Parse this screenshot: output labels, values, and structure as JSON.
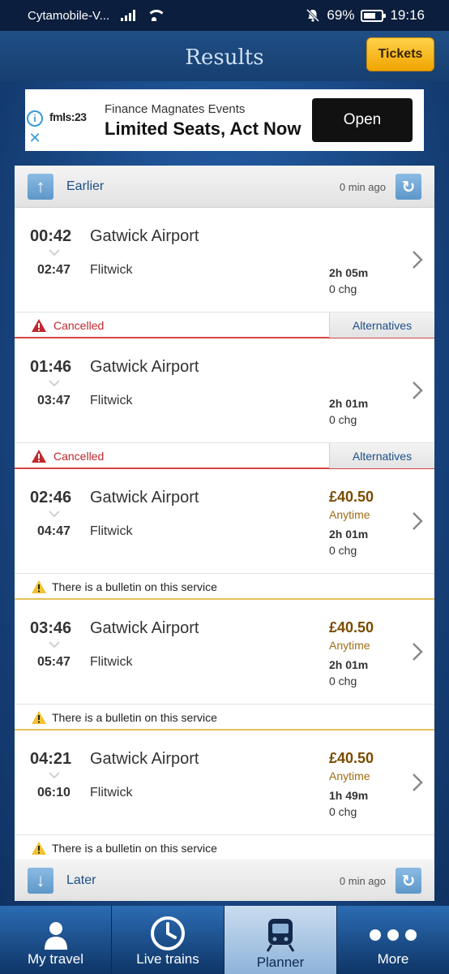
{
  "status_bar": {
    "carrier": "Cytamobile-V...",
    "battery": "69%",
    "time": "19:16",
    "battery_level": 0.69
  },
  "header": {
    "title": "Results",
    "tickets_label": "Tickets"
  },
  "ad": {
    "logo": "fmls:23",
    "line1": "Finance Magnates Events",
    "line2": "Limited Seats, Act Now",
    "open_label": "Open"
  },
  "earlier": {
    "label": "Earlier",
    "updated": "0 min ago"
  },
  "later": {
    "label": "Later",
    "updated": "0 min ago"
  },
  "journeys": [
    {
      "dep_time": "00:42",
      "dep_station": "Gatwick Airport",
      "arr_time": "02:47",
      "arr_station": "Flitwick",
      "fare": "",
      "fare_type": "",
      "duration": "2h 05m",
      "changes": "0 chg",
      "status": "Cancelled",
      "status_kind": "cancelled",
      "alt_label": "Alternatives"
    },
    {
      "dep_time": "01:46",
      "dep_station": "Gatwick Airport",
      "arr_time": "03:47",
      "arr_station": "Flitwick",
      "fare": "",
      "fare_type": "",
      "duration": "2h 01m",
      "changes": "0 chg",
      "status": "Cancelled",
      "status_kind": "cancelled",
      "alt_label": "Alternatives"
    },
    {
      "dep_time": "02:46",
      "dep_station": "Gatwick Airport",
      "arr_time": "04:47",
      "arr_station": "Flitwick",
      "fare": "£40.50",
      "fare_type": "Anytime",
      "duration": "2h 01m",
      "changes": "0 chg",
      "status": "There is a bulletin on this service",
      "status_kind": "bulletin",
      "alt_label": ""
    },
    {
      "dep_time": "03:46",
      "dep_station": "Gatwick Airport",
      "arr_time": "05:47",
      "arr_station": "Flitwick",
      "fare": "£40.50",
      "fare_type": "Anytime",
      "duration": "2h 01m",
      "changes": "0 chg",
      "status": "There is a bulletin on this service",
      "status_kind": "bulletin",
      "alt_label": ""
    },
    {
      "dep_time": "04:21",
      "dep_station": "Gatwick Airport",
      "arr_time": "06:10",
      "arr_station": "Flitwick",
      "fare": "£40.50",
      "fare_type": "Anytime",
      "duration": "1h 49m",
      "changes": "0 chg",
      "status": "There is a bulletin on this service",
      "status_kind": "bulletin",
      "alt_label": ""
    }
  ],
  "tabs": [
    {
      "label": "My travel",
      "icon": "person-icon",
      "active": false
    },
    {
      "label": "Live trains",
      "icon": "clock-icon",
      "active": false
    },
    {
      "label": "Planner",
      "icon": "train-icon",
      "active": true
    },
    {
      "label": "More",
      "icon": "more-dots-icon",
      "active": false
    }
  ],
  "colors": {
    "cancelled": "#c0282d",
    "fare": "#7a4b00",
    "link": "#1c4f86",
    "tickets": "#f0a400"
  }
}
